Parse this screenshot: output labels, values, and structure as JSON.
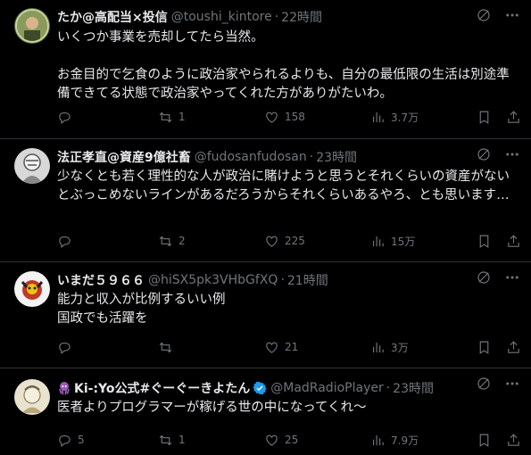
{
  "tweets": [
    {
      "name": "たか@高配当×投信",
      "handle": "@toushi_kintore",
      "sep": "·",
      "time": "22時間",
      "text": "いくつか事業を売却してたら当然。\n\nお金目的で乞食のように政治家やられるよりも、自分の最低限の生活は別途準備できてる状態で政治家やってくれた方がありがたいわ。",
      "replies": "",
      "retweets": "1",
      "likes": "158",
      "views": "3.7万"
    },
    {
      "name": "法正孝直@資産9億社畜",
      "handle": "@fudosanfudosan",
      "sep": "·",
      "time": "23時間",
      "text": "少なくとも若く理性的な人が政治に賭けようと思うとそれくらいの資産がないとぶっこめないラインがあるだろうからそれくらいあるやろ、とも思います…",
      "replies": "",
      "retweets": "2",
      "likes": "225",
      "views": "15万"
    },
    {
      "name": "いまだ５９６６",
      "handle": "@hiSX5pk3VHbGfXQ",
      "sep": "·",
      "time": "21時間",
      "text": "能力と収入が比例するいい例\n国政でも活躍を",
      "replies": "",
      "retweets": "",
      "likes": "21",
      "views": "3万"
    },
    {
      "name": "Ki-:Yo公式#ぐーぐーきよたん",
      "handle": "@MadRadioPlayer",
      "sep": "·",
      "time": "23時間",
      "text": "医者よりプログラマーが稼げる世の中になってくれ〜",
      "replies": "5",
      "retweets": "1",
      "likes": "25",
      "views": "7.9万"
    }
  ],
  "colors": {
    "bg": "#000000",
    "text": "#e7e9ea",
    "muted": "#71767b",
    "border": "#2f3336",
    "verified": "#1d9bf0"
  },
  "icons": [
    "grok-icon",
    "more-icon",
    "reply-icon",
    "retweet-icon",
    "like-icon",
    "views-icon",
    "bookmark-icon",
    "share-icon",
    "verified-icon"
  ]
}
